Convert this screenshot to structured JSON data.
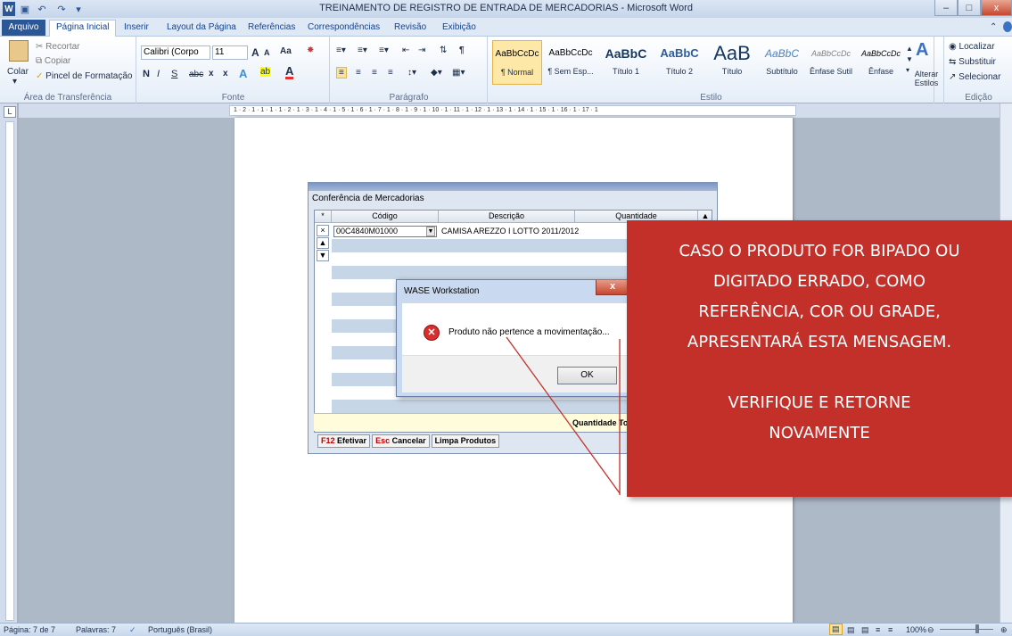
{
  "window": {
    "title": "TREINAMENTO DE REGISTRO DE ENTRADA DE MERCADORIAS - Microsoft Word"
  },
  "tabs": {
    "arquivo": "Arquivo",
    "items": [
      "Página Inicial",
      "Inserir",
      "Layout da Página",
      "Referências",
      "Correspondências",
      "Revisão",
      "Exibição"
    ]
  },
  "clipboard": {
    "colar": "Colar",
    "recortar": "Recortar",
    "copiar": "Copiar",
    "pincel": "Pincel de Formatação",
    "label": "Área de Transferência"
  },
  "font": {
    "name": "Calibri (Corpo",
    "size": "11",
    "label": "Fonte",
    "grow": "A",
    "shrink": "A",
    "case": "Aa",
    "bold": "N",
    "italic": "I",
    "underline": "S",
    "strike": "abc",
    "sub": "x",
    "sup": "x"
  },
  "paragraph": {
    "label": "Parágrafo"
  },
  "styles": {
    "label": "Estilo",
    "items": [
      {
        "sample": "AaBbCcDc",
        "name": "¶ Normal"
      },
      {
        "sample": "AaBbCcDc",
        "name": "¶ Sem Esp..."
      },
      {
        "sample": "AaBbC",
        "name": "Título 1"
      },
      {
        "sample": "AaBbC",
        "name": "Título 2"
      },
      {
        "sample": "AaB",
        "name": "Título"
      },
      {
        "sample": "AaBbC",
        "name": "Subtítulo"
      },
      {
        "sample": "AaBbCcDc",
        "name": "Ênfase Sutil"
      },
      {
        "sample": "AaBbCcDc",
        "name": "Ênfase"
      }
    ],
    "alterar": "Alterar Estilos"
  },
  "editing": {
    "label": "Edição",
    "localizar": "Localizar",
    "substituir": "Substituir",
    "selecionar": "Selecionar"
  },
  "ruler": {
    "marks": "1 · 2 · 1 · 1 · 1 · 1 · 2 · 1 · 3 · 1 · 4 · 1 · 5 · 1 · 6 · 1 · 7 · 1 · 8 · 1 · 9 · 1 · 10 · 1 · 11 · 1 · 12 · 1 · 13 · 1 · 14 · 1 · 15 · 1 · 16 · 1 · 17 · 1",
    "corner": "L"
  },
  "app": {
    "caption": "Conferência de Mercadorias",
    "columns": {
      "star": "*",
      "codigo": "Código",
      "descricao": "Descrição",
      "quantidade": "Quantidade"
    },
    "row": {
      "marker": "×",
      "codigo": "00C4840M01000",
      "descricao": "CAMISA AREZZO I LOTTO 2011/2012"
    },
    "total_label": "Quantidade To",
    "buttons": {
      "f12_key": "F12",
      "f12": "Efetivar",
      "esc_key": "Esc",
      "esc": "Cancelar",
      "limpa": "Limpa Produtos"
    }
  },
  "dialog": {
    "title": "WASE Workstation",
    "close": "x",
    "message": "Produto não pertence a movimentação...",
    "ok": "OK"
  },
  "callout": {
    "lines": [
      "CASO O PRODUTO FOR BIPADO OU",
      "DIGITADO ERRADO, COMO",
      "REFERÊNCIA, COR OU GRADE,",
      "APRESENTARÁ ESTA MENSAGEM.",
      "",
      "VERIFIQUE E RETORNE",
      "NOVAMENTE"
    ]
  },
  "status": {
    "pagina": "Página: 7 de 7",
    "palavras": "Palavras: 7",
    "idioma": "Português (Brasil)",
    "zoom": "100%"
  },
  "colors": {
    "callout": "#c3302a",
    "file_tab": "#2b5797",
    "grid_stripe": "#c7d6e6"
  }
}
